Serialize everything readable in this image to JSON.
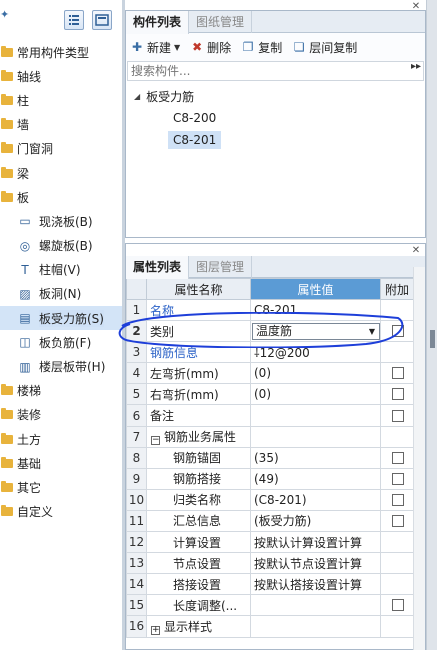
{
  "left_tree": {
    "items": [
      {
        "label": "常用构件类型",
        "child": false
      },
      {
        "label": "轴线",
        "child": false
      },
      {
        "label": "柱",
        "child": false
      },
      {
        "label": "墙",
        "child": false
      },
      {
        "label": "门窗洞",
        "child": false
      },
      {
        "label": "梁",
        "child": false
      },
      {
        "label": "板",
        "child": false
      },
      {
        "label": "现浇板(B)",
        "child": true,
        "icon": "▭"
      },
      {
        "label": "螺旋板(B)",
        "child": true,
        "icon": "◎"
      },
      {
        "label": "柱帽(V)",
        "child": true,
        "icon": "T"
      },
      {
        "label": "板洞(N)",
        "child": true,
        "icon": "▨"
      },
      {
        "label": "板受力筋(S)",
        "child": true,
        "icon": "▤",
        "selected": true
      },
      {
        "label": "板负筋(F)",
        "child": true,
        "icon": "◫"
      },
      {
        "label": "楼层板带(H)",
        "child": true,
        "icon": "▥"
      },
      {
        "label": "楼梯",
        "child": false
      },
      {
        "label": "装修",
        "child": false
      },
      {
        "label": "土方",
        "child": false
      },
      {
        "label": "基础",
        "child": false
      },
      {
        "label": "其它",
        "child": false
      },
      {
        "label": "自定义",
        "child": false
      }
    ]
  },
  "comp_panel": {
    "tabs": [
      {
        "label": "构件列表",
        "active": true
      },
      {
        "label": "图纸管理",
        "active": false
      }
    ],
    "toolbar": {
      "new": "新建",
      "delete": "删除",
      "copy": "复制",
      "layer_copy": "层间复制"
    },
    "search_placeholder": "搜索构件...",
    "tree_root": "板受力筋",
    "items": [
      {
        "label": "C8-200",
        "selected": false
      },
      {
        "label": "C8-201",
        "selected": true
      }
    ]
  },
  "prop_panel": {
    "tabs": [
      {
        "label": "属性列表",
        "active": true
      },
      {
        "label": "图层管理",
        "active": false
      }
    ],
    "headers": {
      "name": "属性名称",
      "value": "属性值",
      "extra": "附加"
    },
    "rows": [
      {
        "num": "1",
        "name": "名称",
        "value": "C8-201",
        "blue": true,
        "check": false,
        "style": ""
      },
      {
        "num": "2",
        "name": "类别",
        "value": "温度筋",
        "blue": false,
        "check": true,
        "style": "combo"
      },
      {
        "num": "3",
        "name": "钢筋信息",
        "value": "⸸12@200",
        "blue": true,
        "check": false,
        "style": ""
      },
      {
        "num": "4",
        "name": "左弯折(mm)",
        "value": "(0)",
        "blue": false,
        "check": true,
        "style": ""
      },
      {
        "num": "5",
        "name": "右弯折(mm)",
        "value": "(0)",
        "blue": false,
        "check": true,
        "style": ""
      },
      {
        "num": "6",
        "name": "备注",
        "value": "",
        "blue": false,
        "check": true,
        "style": ""
      },
      {
        "num": "7",
        "name": "钢筋业务属性",
        "value": "",
        "blue": false,
        "check": false,
        "style": "group-open"
      },
      {
        "num": "8",
        "name": "钢筋锚固",
        "value": "(35)",
        "blue": false,
        "check": true,
        "style": "indent"
      },
      {
        "num": "9",
        "name": "钢筋搭接",
        "value": "(49)",
        "blue": false,
        "check": true,
        "style": "indent"
      },
      {
        "num": "10",
        "name": "归类名称",
        "value": "(C8-201)",
        "blue": false,
        "check": true,
        "style": "indent"
      },
      {
        "num": "11",
        "name": "汇总信息",
        "value": "(板受力筋)",
        "blue": false,
        "check": true,
        "style": "indent"
      },
      {
        "num": "12",
        "name": "计算设置",
        "value": "按默认计算设置计算",
        "blue": false,
        "check": false,
        "style": "indent"
      },
      {
        "num": "13",
        "name": "节点设置",
        "value": "按默认节点设置计算",
        "blue": false,
        "check": false,
        "style": "indent"
      },
      {
        "num": "14",
        "name": "搭接设置",
        "value": "按默认搭接设置计算",
        "blue": false,
        "check": false,
        "style": "indent"
      },
      {
        "num": "15",
        "name": "长度调整(...",
        "value": "",
        "blue": false,
        "check": true,
        "style": "indent"
      },
      {
        "num": "16",
        "name": "显示样式",
        "value": "",
        "blue": false,
        "check": false,
        "style": "group-closed"
      }
    ]
  },
  "colors": {
    "accent": "#5b9bd5",
    "folder": "#e8b33c",
    "selection": "#cfe1f6",
    "annotation": "#1e3fd9"
  }
}
